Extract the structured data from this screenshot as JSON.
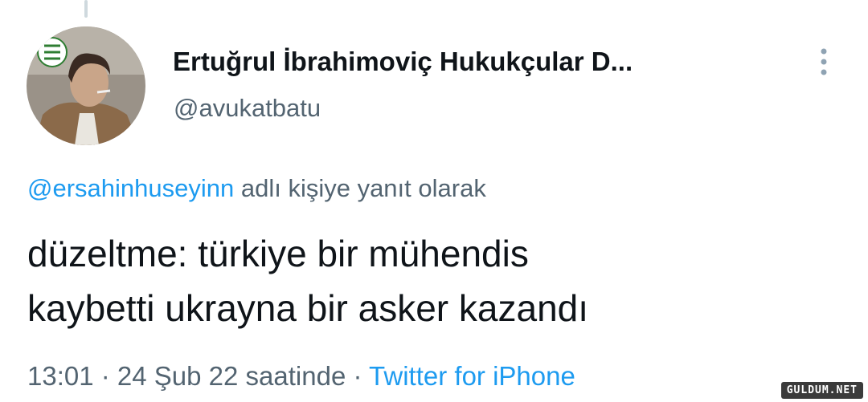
{
  "tweet": {
    "author": {
      "display_name": "Ertuğrul İbrahimoviç Hukukçular D...",
      "handle": "@avukatbatu"
    },
    "reply": {
      "mention": "@ersahinhuseyinn",
      "suffix": " adlı kişiye yanıt olarak"
    },
    "text_lines": [
      "düzeltme: türkiye bir mühendis",
      "kaybetti ukrayna bir asker kazandı"
    ],
    "meta": {
      "time_date": "13:01 · 24 Şub 22 saatinde",
      "separator": " · ",
      "source": "Twitter for iPhone"
    }
  },
  "watermark": "GULDUM.NET",
  "colors": {
    "text_primary": "#0f1419",
    "text_secondary": "#536471",
    "accent": "#1d9bf0"
  }
}
